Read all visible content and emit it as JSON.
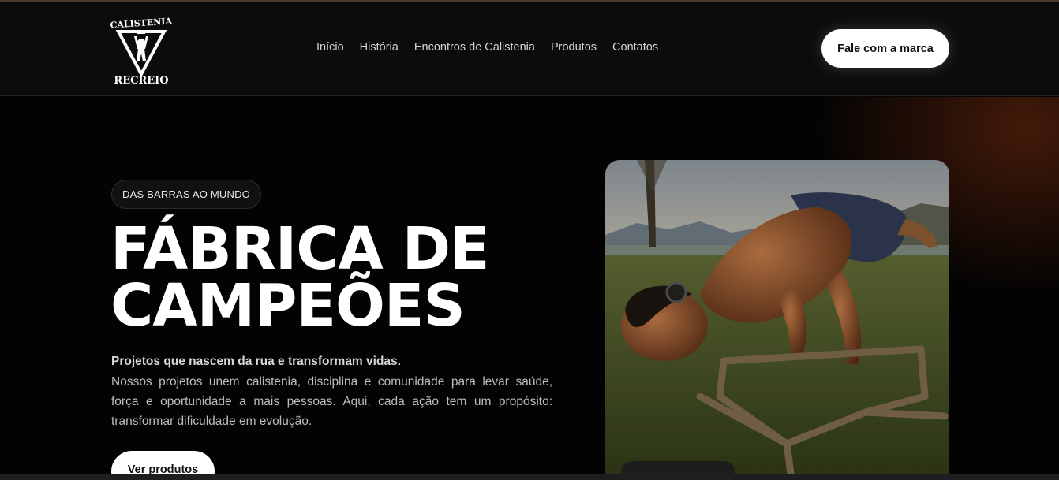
{
  "brand": {
    "name_top": "CALISTENIA",
    "name_bottom": "RECREIO"
  },
  "nav": {
    "items": [
      {
        "label": "Início"
      },
      {
        "label": "História"
      },
      {
        "label": "Encontros de Calistenia"
      },
      {
        "label": "Produtos"
      },
      {
        "label": "Contatos"
      }
    ]
  },
  "header": {
    "cta_label": "Fale com a marca"
  },
  "hero": {
    "badge": "DAS BARRAS AO MUNDO",
    "title_line1": "FÁBRICA DE",
    "title_line2": "CAMPEÕES",
    "lead": "Projetos que nascem da rua e transformam vidas.",
    "body": "Nossos projetos unem calistenia, disciplina e comunidade para levar saúde, força e oportunidade a mais pessoas. Aqui, cada ação tem um propósito: transformar dificuldade em evolução.",
    "cta_label": "Ver produtos"
  },
  "colors": {
    "accent_glow": "#7a2d0f",
    "button_bg": "#ffffff",
    "background": "#030303"
  }
}
